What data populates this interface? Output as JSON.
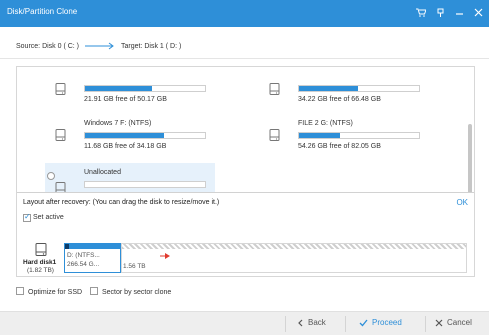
{
  "window": {
    "title": "Disk/Partition Clone"
  },
  "titlebar_icons": [
    "cart-icon",
    "pin-icon",
    "minimize-icon",
    "close-icon"
  ],
  "source_line": {
    "source": "Source:  Disk 0 ( C: )",
    "target": "Target:  Disk 1 ( D: )"
  },
  "partitions": [
    {
      "name": "",
      "free": "21.91 GB free of 50.17 GB",
      "used_fraction": 0.56
    },
    {
      "name": "",
      "free": "34.22 GB free of 66.48 GB",
      "used_fraction": 0.49
    },
    {
      "name": "Windows 7 F: (NTFS)",
      "free": "11.68 GB free of 34.18 GB",
      "used_fraction": 0.66
    },
    {
      "name": "FILE 2 G: (NTFS)",
      "free": "54.26 GB free of 82.05 GB",
      "used_fraction": 0.34
    },
    {
      "name": "Unallocated",
      "free": "",
      "used_fraction": 0
    }
  ],
  "layout": {
    "header": "Layout after recovery: (You can drag the disk to resize/move it.)",
    "ok": "OK",
    "set_active": "Set active",
    "set_active_checked": true,
    "disk_name": "Hard disk1",
    "disk_size": "(1.82 TB)",
    "seg1_line1": "D: (NTFS...",
    "seg1_line2": "266.54 G...",
    "seg2_size": "1.56 TB"
  },
  "options": {
    "optimize_ssd": "Optimize for SSD",
    "sector_clone": "Sector by sector clone"
  },
  "footer": {
    "back": "Back",
    "proceed": "Proceed",
    "cancel": "Cancel"
  },
  "colors": {
    "accent": "#2e8fd8",
    "footer_bg": "#eeeeee",
    "selected_bg": "#e6f1fb"
  }
}
